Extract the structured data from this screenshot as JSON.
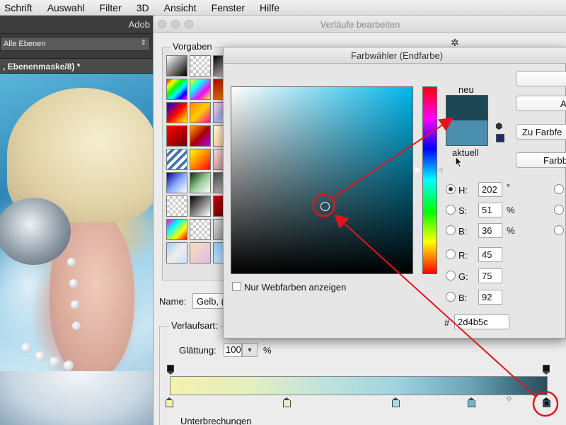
{
  "menubar": {
    "items": [
      "Schrift",
      "Auswahl",
      "Filter",
      "3D",
      "Ansicht",
      "Fenster",
      "Hilfe"
    ]
  },
  "photoshop": {
    "app_title": "Adob",
    "layer_filter": "Alle Ebenen",
    "document_tab": ", Ebenenmaske/8) *"
  },
  "gradient_editor": {
    "title": "Verläufe bearbeiten",
    "presets_label": "Vorgaben",
    "name_label": "Name:",
    "name_value": "Gelb, (",
    "type_label": "Verlaufsart:",
    "smoothing_label": "Glättung:",
    "smoothing_value": "100",
    "smoothing_unit": "%",
    "stops_label": "Unterbrechungen",
    "gradient_colors": [
      "#f4f2ad",
      "#c2e3dc",
      "#9fd3e1",
      "#6aa3b5",
      "#2d4b5c"
    ],
    "color_stops": [
      {
        "position": 0,
        "color": "#f4f2ad"
      },
      {
        "position": 0.31,
        "color": "#e8edd2"
      },
      {
        "position": 0.6,
        "color": "#aadbe0"
      },
      {
        "position": 0.8,
        "color": "#77b6c2"
      },
      {
        "position": 0.999,
        "color": "#2d4b5c",
        "selected": true
      }
    ]
  },
  "color_picker": {
    "title": "Farbwähler (Endfarbe)",
    "new_label": "neu",
    "current_label": "aktuell",
    "new_color": "#1d4654",
    "current_color": "#4b8fae",
    "fields": {
      "H": {
        "label": "H:",
        "value": "202",
        "unit": "°"
      },
      "S": {
        "label": "S:",
        "value": "51",
        "unit": "%"
      },
      "Bv": {
        "label": "B:",
        "value": "36",
        "unit": "%"
      },
      "R": {
        "label": "R:",
        "value": "45"
      },
      "G": {
        "label": "G:",
        "value": "75"
      },
      "Bc": {
        "label": "B:",
        "value": "92"
      }
    },
    "hex_label": "#",
    "hex_value": "2d4b5c",
    "web_only_label": "Nur Webfarben anzeigen",
    "buttons": {
      "ok": "",
      "a": "A",
      "zu": "Zu Farbfe",
      "farbb": "Farbb"
    },
    "annotation_color": "#e0141e"
  }
}
